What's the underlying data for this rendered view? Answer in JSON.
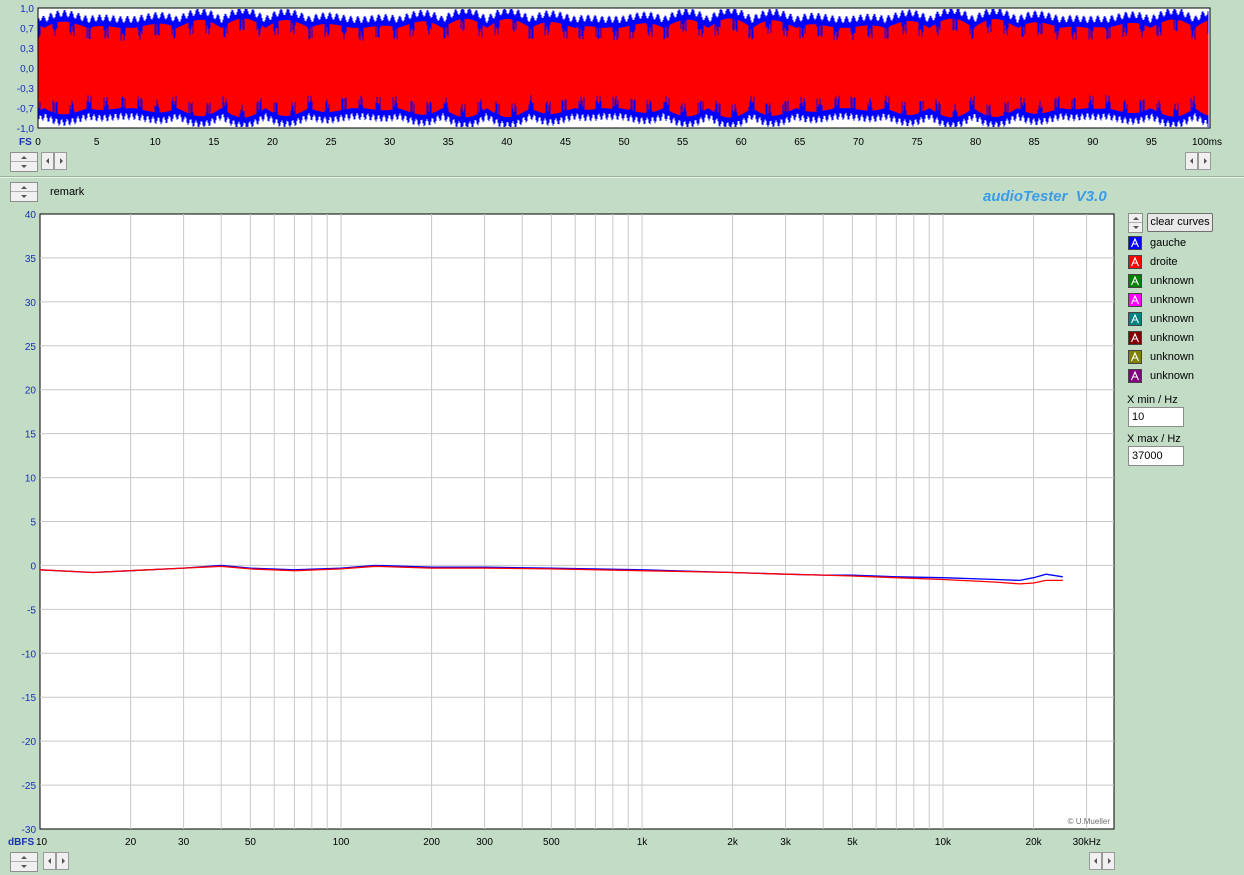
{
  "waveform": {
    "y_ticks": [
      "1,0",
      "0,7",
      "0,3",
      "0,0",
      "-0,3",
      "-0,7",
      "-1,0"
    ],
    "y_unit": "FS",
    "x_ticks": [
      "0",
      "5",
      "10",
      "15",
      "20",
      "25",
      "30",
      "35",
      "40",
      "45",
      "50",
      "55",
      "60",
      "65",
      "70",
      "75",
      "80",
      "85",
      "90",
      "95",
      "100ms"
    ],
    "channels": [
      {
        "color": "#0000ff"
      },
      {
        "color": "#ff0000"
      }
    ]
  },
  "panel": {
    "remark_label": "remark",
    "app_title": "audioTester  V3.0",
    "watermark": "© U.Mueller"
  },
  "controls": {
    "clear_label": "clear curves",
    "xmin_label": "X min / Hz",
    "xmin_value": "10",
    "xmax_label": "X max / Hz",
    "xmax_value": "37000"
  },
  "legend": [
    {
      "label": "gauche",
      "color": "#0000ff"
    },
    {
      "label": "droite",
      "color": "#ff0000"
    },
    {
      "label": "unknown",
      "color": "#008000"
    },
    {
      "label": "unknown",
      "color": "#ff00ff"
    },
    {
      "label": "unknown",
      "color": "#008080"
    },
    {
      "label": "unknown",
      "color": "#800000"
    },
    {
      "label": "unknown",
      "color": "#808000"
    },
    {
      "label": "unknown",
      "color": "#800080"
    }
  ],
  "chart_data": {
    "type": "line",
    "x_scale": "log",
    "xlim": [
      10,
      37000
    ],
    "ylim": [
      -30,
      40
    ],
    "y_ticks": [
      "40",
      "35",
      "30",
      "25",
      "20",
      "15",
      "10",
      "5",
      "0",
      "-5",
      "-10",
      "-15",
      "-20",
      "-25",
      "-30"
    ],
    "y_unit": "dBFS",
    "x_ticks": [
      {
        "value": 10,
        "label": "10"
      },
      {
        "value": 20,
        "label": "20"
      },
      {
        "value": 30,
        "label": "30"
      },
      {
        "value": 50,
        "label": "50"
      },
      {
        "value": 100,
        "label": "100"
      },
      {
        "value": 200,
        "label": "200"
      },
      {
        "value": 300,
        "label": "300"
      },
      {
        "value": 500,
        "label": "500"
      },
      {
        "value": 1000,
        "label": "1k"
      },
      {
        "value": 2000,
        "label": "2k"
      },
      {
        "value": 3000,
        "label": "3k"
      },
      {
        "value": 5000,
        "label": "5k"
      },
      {
        "value": 10000,
        "label": "10k"
      },
      {
        "value": 20000,
        "label": "20k"
      },
      {
        "value": 30000,
        "label": "30kHz"
      }
    ],
    "grid": true,
    "series": [
      {
        "name": "gauche",
        "color": "#0000ff",
        "x": [
          10,
          15,
          20,
          30,
          40,
          50,
          70,
          100,
          130,
          200,
          300,
          500,
          1000,
          2000,
          3000,
          4000,
          5000,
          7000,
          10000,
          15000,
          18000,
          20000,
          22000,
          25000
        ],
        "y": [
          -0.5,
          -0.8,
          -0.6,
          -0.3,
          0.0,
          -0.3,
          -0.5,
          -0.3,
          0.0,
          -0.2,
          -0.2,
          -0.3,
          -0.5,
          -0.8,
          -1.0,
          -1.1,
          -1.1,
          -1.3,
          -1.4,
          -1.6,
          -1.7,
          -1.4,
          -1.0,
          -1.3
        ]
      },
      {
        "name": "droite",
        "color": "#ff0000",
        "x": [
          10,
          15,
          20,
          30,
          40,
          50,
          70,
          100,
          130,
          200,
          300,
          500,
          1000,
          2000,
          3000,
          4000,
          5000,
          7000,
          10000,
          15000,
          18000,
          20000,
          22000,
          25000
        ],
        "y": [
          -0.5,
          -0.8,
          -0.6,
          -0.3,
          -0.1,
          -0.4,
          -0.6,
          -0.4,
          -0.1,
          -0.3,
          -0.3,
          -0.4,
          -0.6,
          -0.8,
          -1.0,
          -1.1,
          -1.2,
          -1.4,
          -1.6,
          -1.9,
          -2.1,
          -2.0,
          -1.7,
          -1.7
        ]
      }
    ]
  }
}
